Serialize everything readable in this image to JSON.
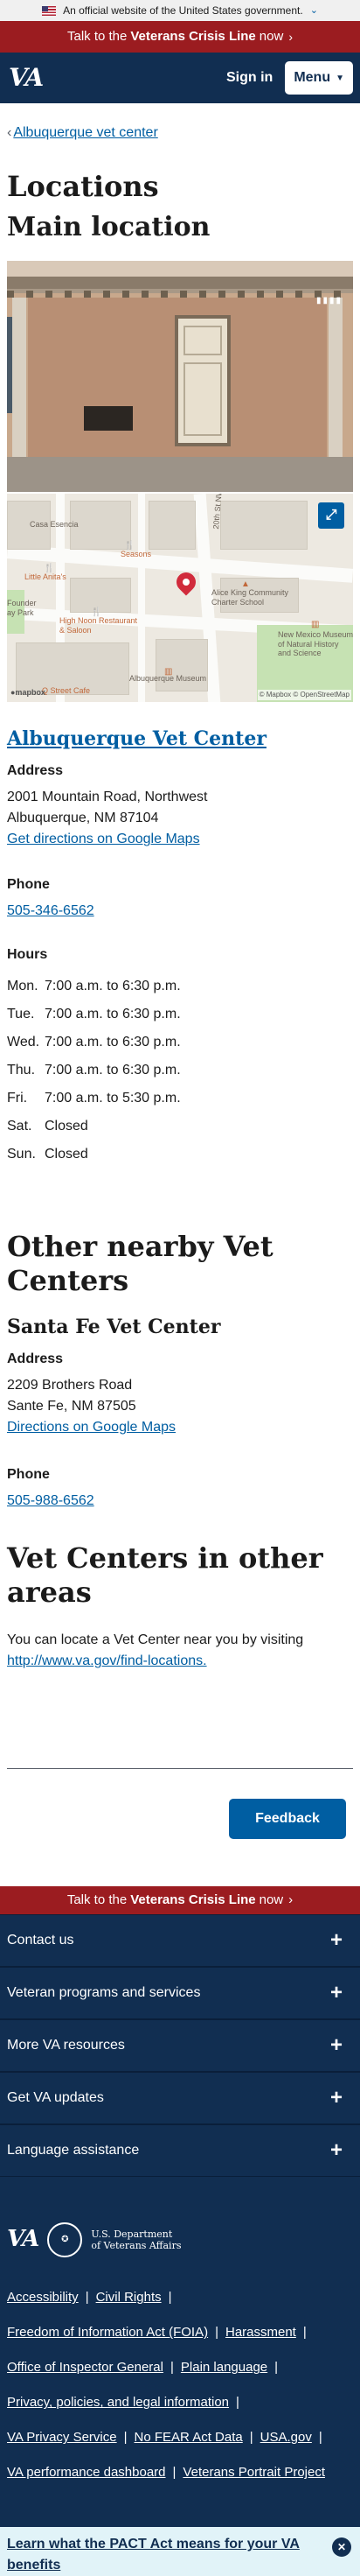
{
  "gov_banner": {
    "text": "An official website of the United States government."
  },
  "crisis": {
    "pre": "Talk to the",
    "strong": "Veterans Crisis Line",
    "post": "now"
  },
  "header": {
    "logo": "VA",
    "sign_in": "Sign in",
    "menu": "Menu"
  },
  "breadcrumb": {
    "back_link": "Albuquerque vet center"
  },
  "page": {
    "title": "Locations",
    "main_location_heading": "Main location"
  },
  "map_labels": {
    "casa": "Casa Esencia",
    "seasons": "Seasons",
    "little_anitas": "Little Anita's",
    "founders_park": "Founder\nay Park",
    "high_noon": "High Noon Restaurant\n& Saloon",
    "street": "20th St NW",
    "school": "Alice King Community\nCharter School",
    "museum_nm": "New Mexico Museum\nof Natural History\nand Science",
    "abq_museum": "Albuquerque Museum",
    "cafe": "Q Street Cafe",
    "attribution": "© Mapbox © OpenStreetMap"
  },
  "main_center": {
    "name": "Albuquerque Vet Center",
    "address_label": "Address",
    "address_line1": "2001 Mountain Road, Northwest",
    "address_line2": "Albuquerque, NM 87104",
    "directions": "Get directions on Google Maps",
    "phone_label": "Phone",
    "phone": "505-346-6562",
    "hours_label": "Hours",
    "hours": [
      {
        "day": "Mon.",
        "time": "7:00 a.m. to 6:30 p.m."
      },
      {
        "day": "Tue.",
        "time": "7:00 a.m. to 6:30 p.m."
      },
      {
        "day": "Wed.",
        "time": "7:00 a.m. to 6:30 p.m."
      },
      {
        "day": "Thu.",
        "time": "7:00 a.m. to 6:30 p.m."
      },
      {
        "day": "Fri.",
        "time": "7:00 a.m. to 5:30 p.m."
      },
      {
        "day": "Sat.",
        "time": "Closed"
      },
      {
        "day": "Sun.",
        "time": "Closed"
      }
    ]
  },
  "nearby": {
    "heading": "Other nearby Vet Centers",
    "name": "Santa Fe Vet Center",
    "address_label": "Address",
    "address_line1": "2209 Brothers Road",
    "address_line2": "Sante Fe, NM 87505",
    "directions": "Directions on Google Maps",
    "phone_label": "Phone",
    "phone": "505-988-6562"
  },
  "other_areas": {
    "heading": "Vet Centers in other areas",
    "text": "You can locate a Vet Center near you by visiting",
    "link": "http://www.va.gov/find-locations."
  },
  "feedback": "Feedback",
  "footer": {
    "crisis": {
      "pre": "Talk to the",
      "strong": "Veterans Crisis Line",
      "post": "now"
    },
    "accordions": [
      "Contact us",
      "Veteran programs and services",
      "More VA resources",
      "Get VA updates",
      "Language assistance"
    ],
    "logo": "VA",
    "dept_line1": "U.S. Department",
    "dept_line2": "of Veterans Affairs",
    "links": {
      "accessibility": "Accessibility",
      "civil_rights": "Civil Rights",
      "foia": "Freedom of Information Act (FOIA)",
      "harassment": "Harassment",
      "oig": "Office of Inspector General",
      "plain_language": "Plain language",
      "privacy": "Privacy, policies, and legal information",
      "va_privacy": "VA Privacy Service",
      "no_fear": "No FEAR Act Data",
      "usa_gov": "USA.gov",
      "perf": "VA performance dashboard",
      "portrait": "Veterans Portrait Project"
    }
  },
  "pact": {
    "text": "Learn what the PACT Act means for your VA benefits"
  }
}
